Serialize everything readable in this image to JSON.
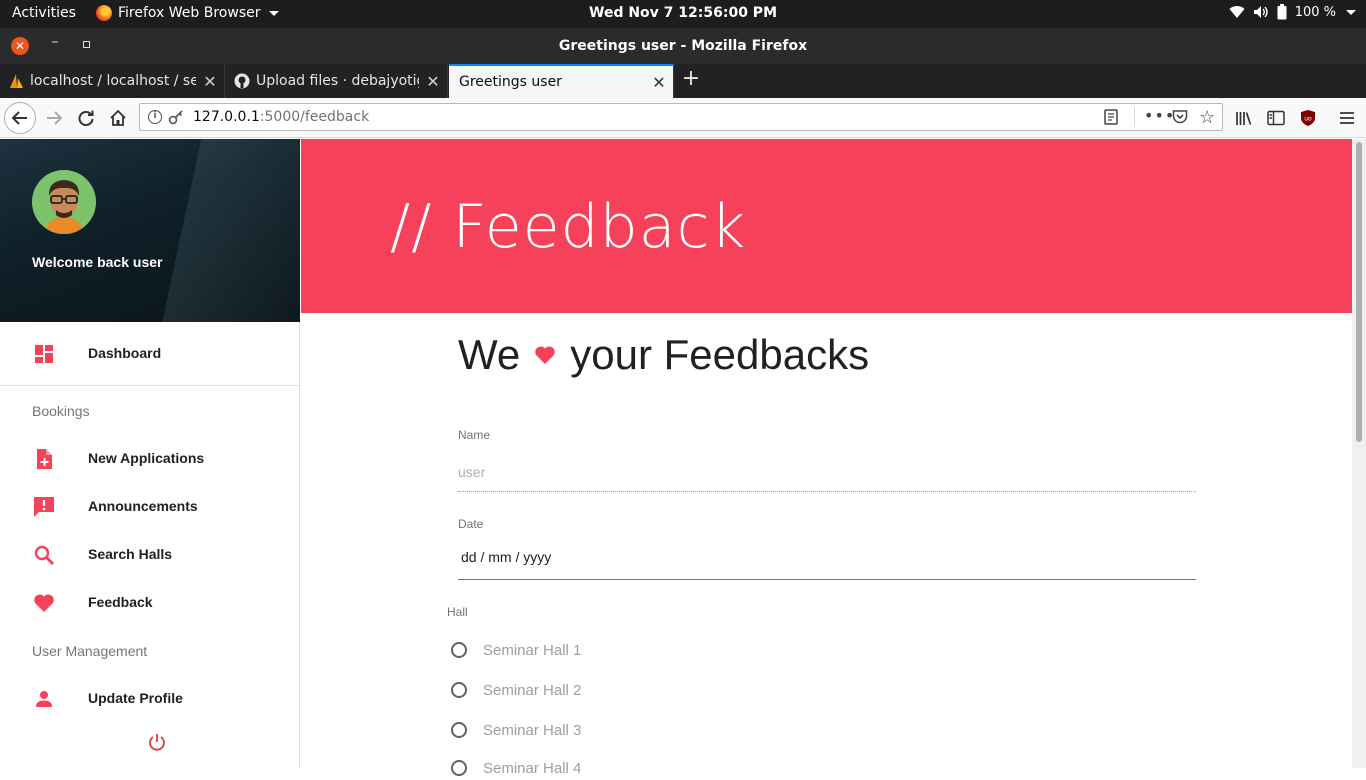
{
  "system_bar": {
    "activities": "Activities",
    "app_name": "Firefox Web Browser",
    "clock": "Wed Nov 7  12:56:00 PM",
    "battery": "100 %"
  },
  "window": {
    "title": "Greetings user - Mozilla Firefox"
  },
  "tabs": [
    {
      "label": "localhost / localhost / se"
    },
    {
      "label": "Upload files · debajyotig"
    },
    {
      "label": "Greetings user"
    }
  ],
  "address_bar": {
    "host": "127.0.0.1",
    "path": ":5000/feedback"
  },
  "sidebar": {
    "welcome": "Welcome back user",
    "dashboard": "Dashboard",
    "section_bookings": "Bookings",
    "new_applications": "New Applications",
    "announcements": "Announcements",
    "search_halls": "Search Halls",
    "feedback": "Feedback",
    "section_user_management": "User Management",
    "update_profile": "Update Profile"
  },
  "page": {
    "hero_title": "// Feedback",
    "heading_before": "We",
    "heading_after": "your Feedbacks",
    "name_label": "Name",
    "name_placeholder": "user",
    "date_label": "Date",
    "date_placeholder": "dd / mm / yyyy",
    "hall_label": "Hall",
    "halls": [
      "Seminar Hall 1",
      "Seminar Hall 2",
      "Seminar Hall 3",
      "Seminar Hall 4"
    ]
  },
  "colors": {
    "accent": "#f5425a",
    "sidebar_icon": "#f5425a",
    "topbar": "#1d1d1d"
  }
}
